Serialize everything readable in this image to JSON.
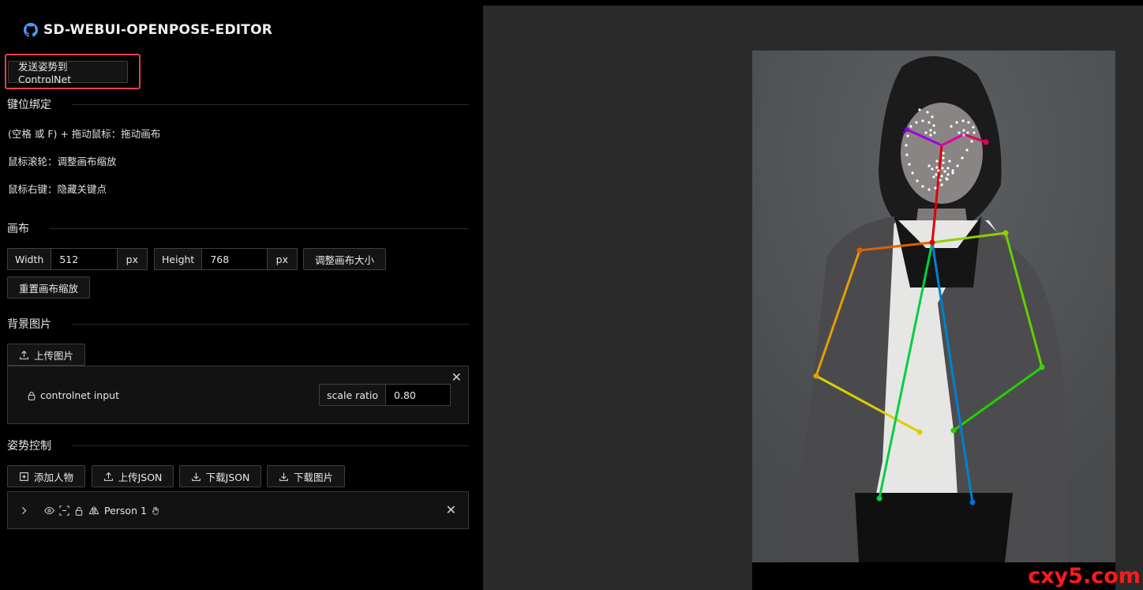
{
  "app": {
    "title": "SD-WEBUI-OPENPOSE-EDITOR"
  },
  "actions": {
    "send_to_controlnet": "发送姿势到ControlNet"
  },
  "keybindings": {
    "title": "键位绑定",
    "items": [
      "(空格 或 F) + 拖动鼠标：拖动画布",
      "鼠标滚轮：调整画布缩放",
      "鼠标右键：隐藏关键点"
    ]
  },
  "canvas_settings": {
    "title": "画布",
    "width_label": "Width",
    "width_value": "512",
    "width_unit": "px",
    "height_label": "Height",
    "height_value": "768",
    "height_unit": "px",
    "resize_button": "调整画布大小",
    "reset_zoom_button": "重置画布缩放"
  },
  "background": {
    "title": "背景图片",
    "upload_button": "上传图片",
    "layer_name": "controlnet input",
    "scale_label": "scale ratio",
    "scale_value": "0.80"
  },
  "pose_control": {
    "title": "姿势控制",
    "add_person": "添加人物",
    "upload_json": "上传JSON",
    "download_json": "下载JSON",
    "download_image": "下载图片",
    "person_label": "Person 1"
  },
  "watermark": "cxy5.com",
  "colors": {
    "accent_red": "#e8414a",
    "panel_bg": "#121212",
    "canvas_bg": "#2a2a2a"
  }
}
